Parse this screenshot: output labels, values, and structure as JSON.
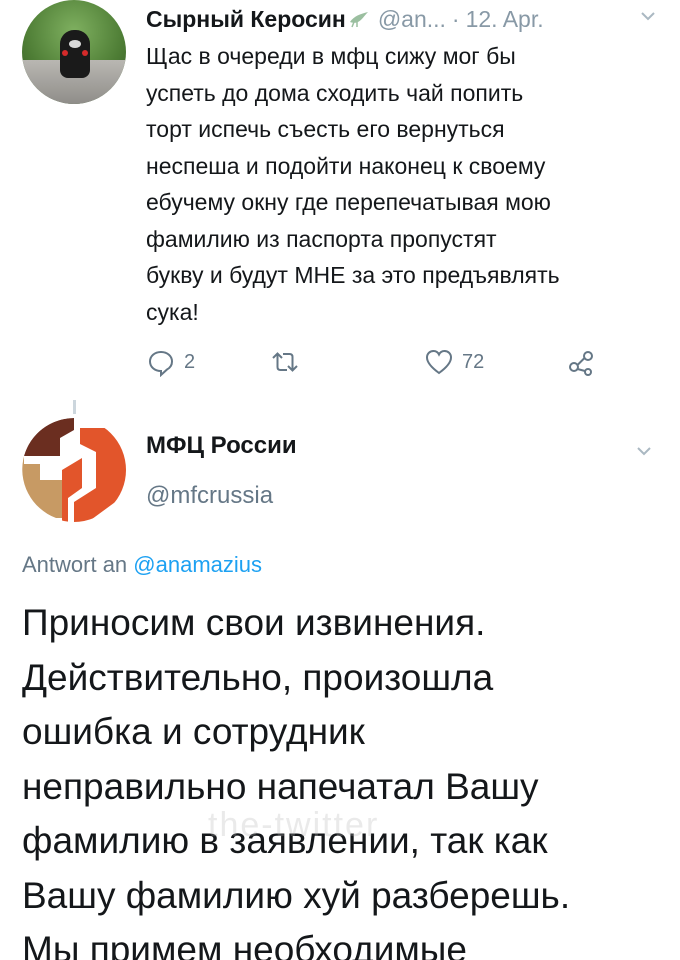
{
  "tweet1": {
    "author_name": "Сырный Керосин",
    "handle": "@an...",
    "date": "12. Apr.",
    "separator": "·",
    "body_lines": [
      "Щас в очереди в мфц сижу мог бы",
      "успеть до дома сходить чай попить",
      "торт испечь съесть его вернуться",
      "неспеша и подойти наконец к своему",
      "ебучему окну где перепечатывая мою",
      "фамилию из паспорта пропустят",
      "букву и будут МНЕ за это предъявлять",
      "сука!"
    ],
    "actions": {
      "reply_count": "2",
      "retweet_count": "",
      "like_count": "72"
    }
  },
  "tweet2": {
    "author_name": "МФЦ России",
    "handle": "@mfcrussia",
    "reply_prefix": "Antwort an",
    "reply_handle": "@anamazius",
    "body_lines": [
      "Приносим свои извинения.",
      "Действительно, произошла",
      "ошибка и сотрудник",
      "неправильно напечатал Вашу",
      "фамилию в заявлении, так как",
      "Вашу фамилию хуй разберешь.",
      "Мы примем необходимые"
    ]
  },
  "watermark": "the-twitter",
  "icons": {
    "reply": "reply-icon",
    "retweet": "retweet-icon",
    "like": "heart-icon",
    "share": "share-icon",
    "menu": "chevron-down-icon",
    "dove": "dove-icon"
  },
  "colors": {
    "text": "#14171a",
    "muted": "#657786",
    "link": "#1da1f2",
    "mfc_orange": "#e2552b",
    "mfc_tan": "#c79a64",
    "mfc_brown": "#6b2e20"
  }
}
